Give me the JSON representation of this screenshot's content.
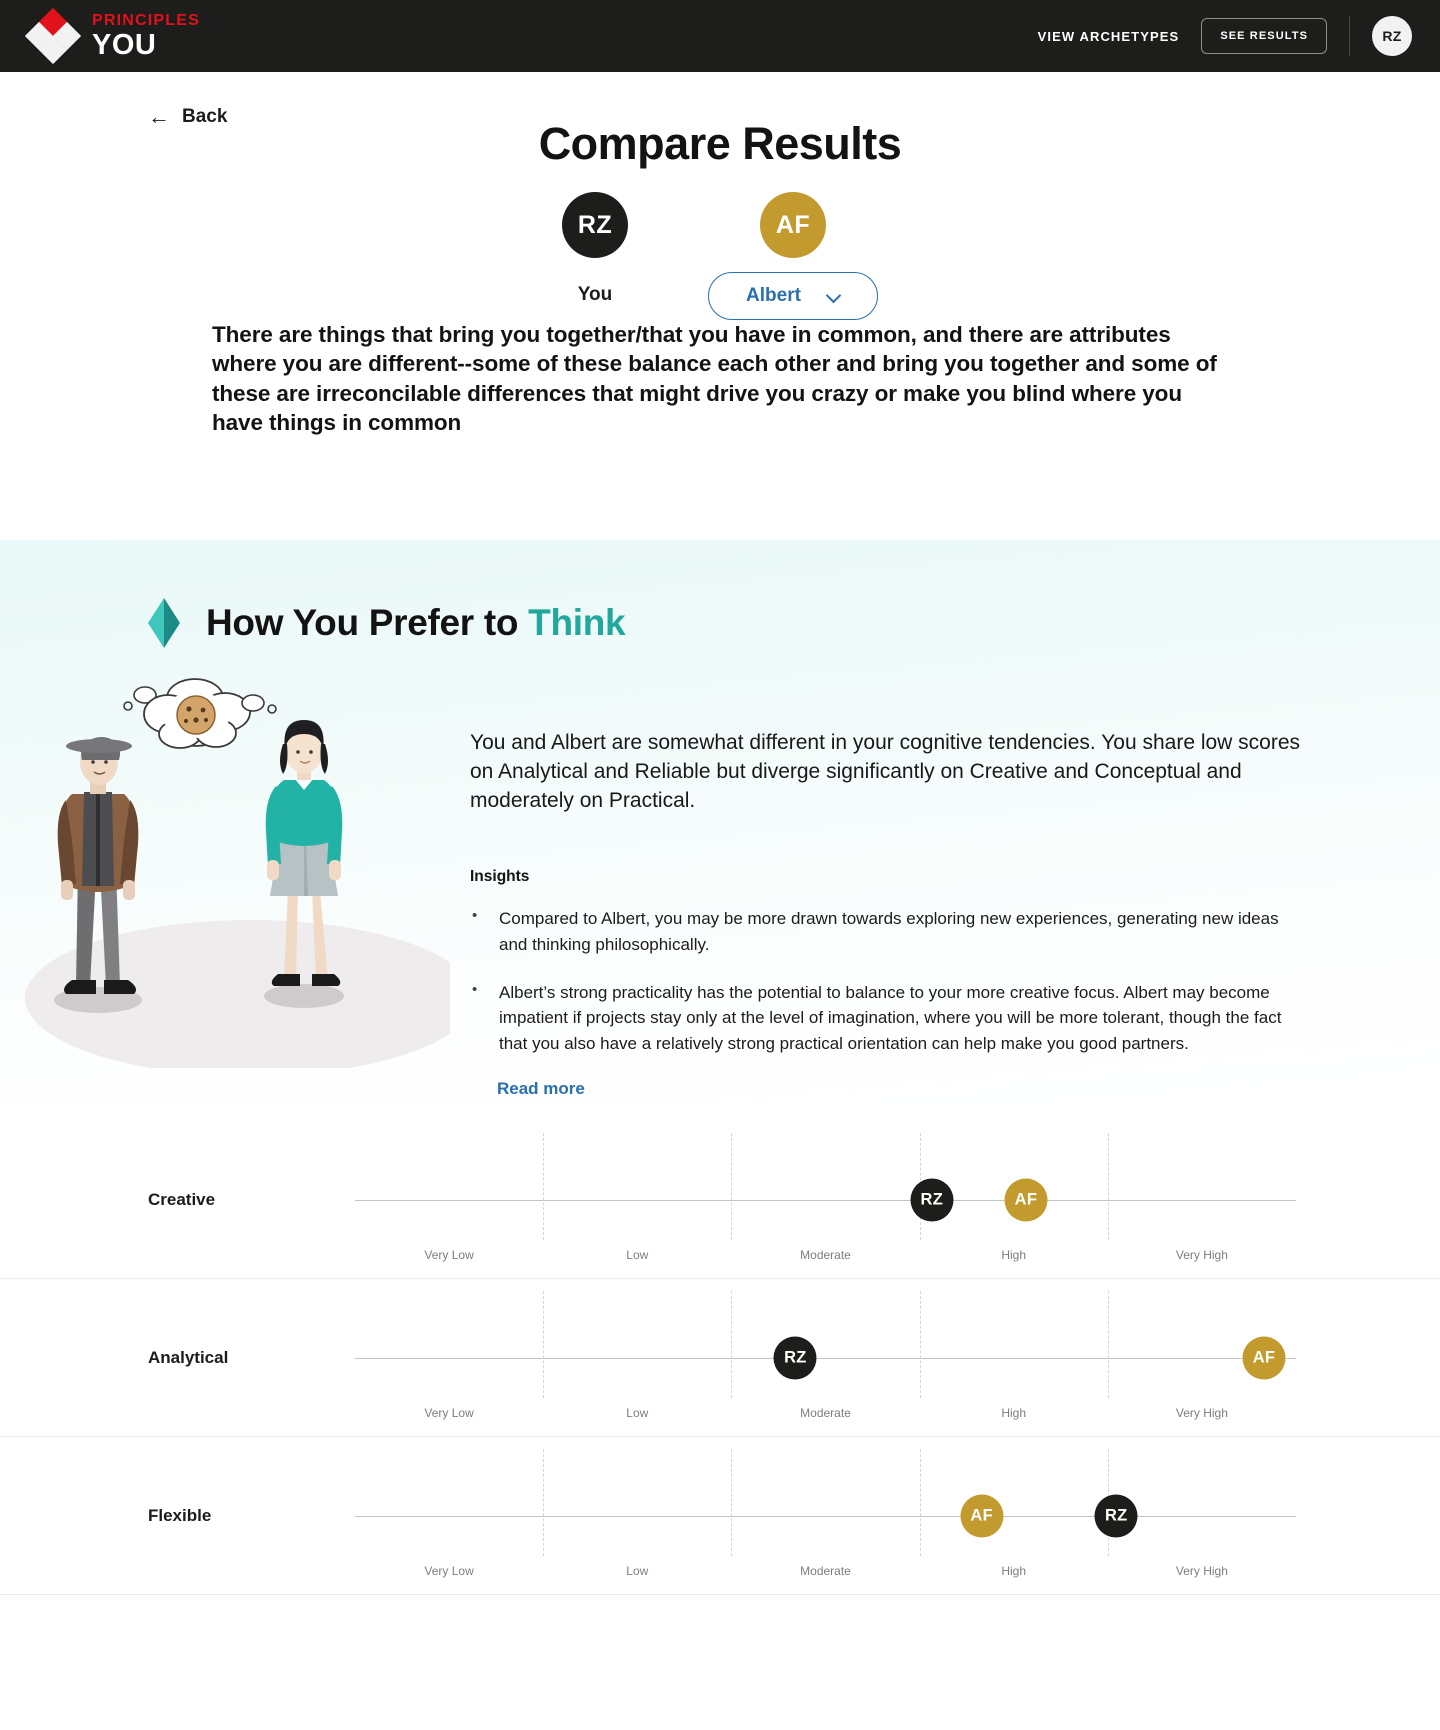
{
  "header": {
    "brand_top": "PRINCIPLES",
    "brand_bottom": "YOU",
    "nav_link": "VIEW ARCHETYPES",
    "results_button": "SEE RESULTS",
    "avatar_initials": "RZ",
    "colors": {
      "background": "#1d1d1b",
      "accent_red": "#e1121c"
    }
  },
  "page": {
    "back_label": "Back",
    "title": "Compare Results",
    "you": {
      "initials": "RZ",
      "label": "You",
      "color": "#1d1d1b"
    },
    "other": {
      "initials": "AF",
      "label": "Albert",
      "color": "#c29a2e"
    },
    "intro": "There are things that bring you together/that you have in common, and there are attributes where you are different--some of these balance each other and bring you together and some of these are irreconcilable differences that might drive you crazy or make you blind where you have things in common"
  },
  "section": {
    "title_prefix": "How You Prefer to ",
    "title_accent": "Think",
    "accent_color": "#21a79b",
    "lede": "You and Albert are somewhat different in your cognitive tendencies. You share low scores on Analytical and Reliable but diverge significantly on Creative and Conceptual and moderately on Practical.",
    "insights_heading": "Insights",
    "insights": [
      "Compared to Albert, you may be more drawn towards exploring new experiences, generating new ideas and thinking philosophically.",
      "Albert’s strong practicality has the potential to balance to your more creative focus. Albert may become impatient if projects stay only at the level of imagination, where you will be more tolerant, though the fact that you also have a relatively strong practical orientation can help make you good partners."
    ],
    "read_more": "Read more"
  },
  "chart_data": {
    "type": "scatter",
    "title": "How You Prefer to Think",
    "xlabel": "",
    "ylabel": "",
    "tick_labels": [
      "Very Low",
      "Low",
      "Moderate",
      "High",
      "Very High"
    ],
    "xlim": [
      0,
      5
    ],
    "grid": true,
    "legend": [
      {
        "name": "You",
        "initials": "RZ",
        "color": "#1d1d1b"
      },
      {
        "name": "Albert",
        "initials": "AF",
        "color": "#c29a2e"
      }
    ],
    "categories": [
      "Creative",
      "Analytical",
      "Flexible"
    ],
    "series": [
      {
        "name": "You",
        "initials": "RZ",
        "color": "#1d1d1b",
        "values": [
          3.62,
          2.34,
          4.05
        ]
      },
      {
        "name": "Albert",
        "initials": "AF",
        "color": "#c29a2e",
        "values": [
          3.67,
          4.82,
          3.67
        ]
      }
    ],
    "rows": [
      {
        "label": "Creative",
        "markers": [
          {
            "initials": "RZ",
            "color": "#1d1d1b",
            "pct": 61.3
          },
          {
            "initials": "AF",
            "color": "#c29a2e",
            "pct": 71.3
          }
        ]
      },
      {
        "label": "Analytical",
        "markers": [
          {
            "initials": "RZ",
            "color": "#1d1d1b",
            "pct": 46.8
          },
          {
            "initials": "AF",
            "color": "#c29a2e",
            "pct": 96.6
          }
        ]
      },
      {
        "label": "Flexible",
        "markers": [
          {
            "initials": "AF",
            "color": "#c29a2e",
            "pct": 66.6
          },
          {
            "initials": "RZ",
            "color": "#1d1d1b",
            "pct": 80.9
          }
        ]
      }
    ]
  }
}
